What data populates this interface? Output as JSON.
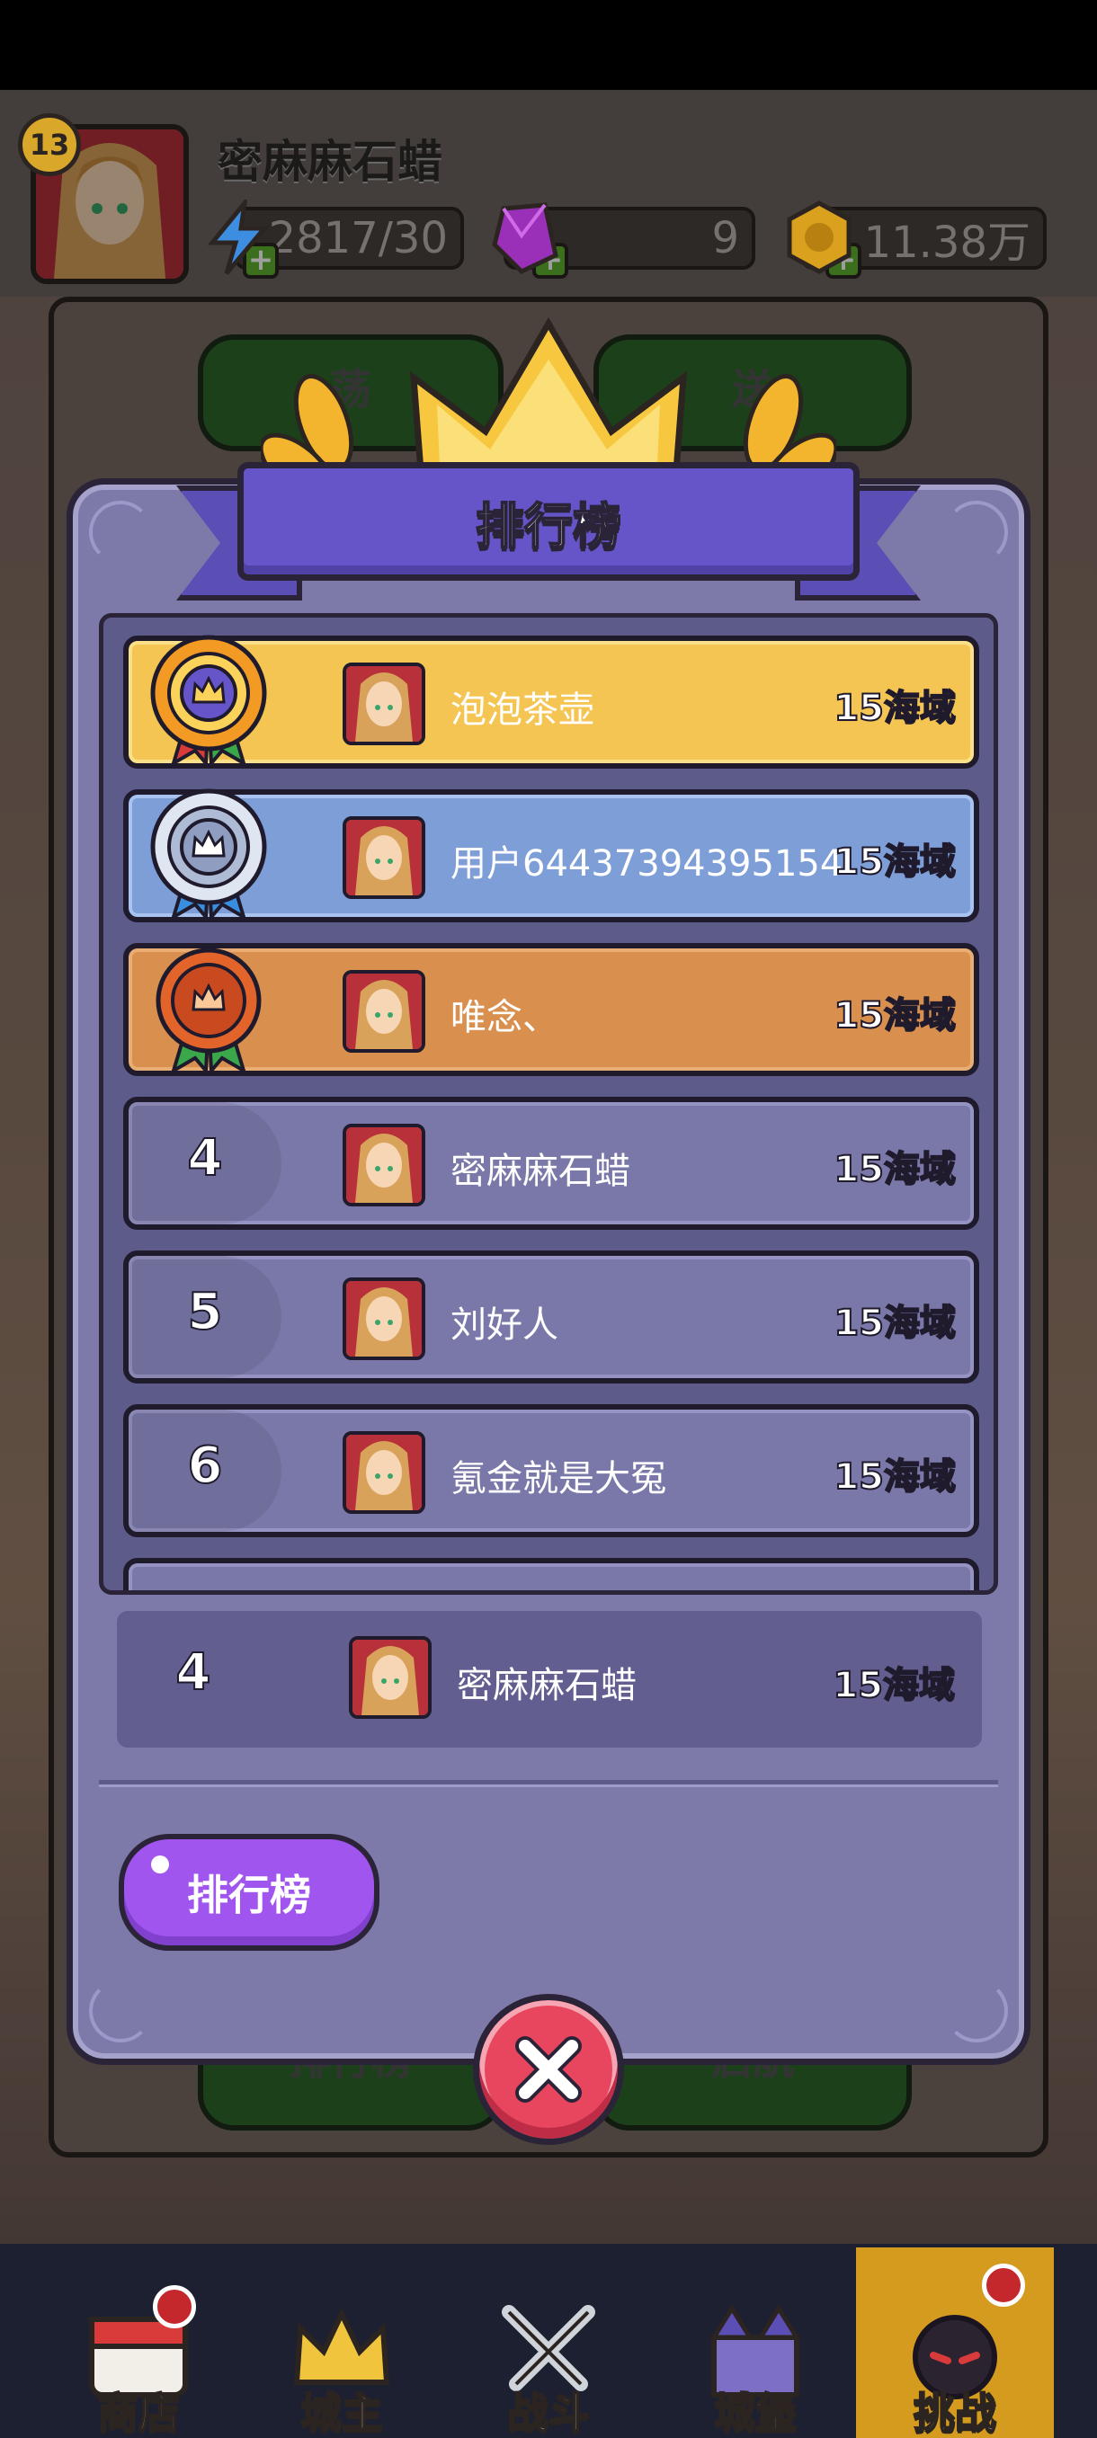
{
  "player": {
    "level": "13",
    "name": "密麻麻石蜡",
    "energy": "2817/30",
    "gems": "9",
    "coins": "11.38万"
  },
  "background_buttons": {
    "top_left": "荡",
    "top_right": "送",
    "bottom_left": "排行榜",
    "bottom_right": "启航"
  },
  "modal": {
    "title": "排行榜",
    "rows": [
      {
        "rank": "1",
        "name": "泡泡茶壶",
        "zone": "15海域",
        "style": "gold"
      },
      {
        "rank": "2",
        "name": "用户64437394395154",
        "zone": "15海域",
        "style": "silver"
      },
      {
        "rank": "3",
        "name": "唯念、",
        "zone": "15海域",
        "style": "bronze"
      },
      {
        "rank": "4",
        "name": "密麻麻石蜡",
        "zone": "15海域",
        "style": "plain"
      },
      {
        "rank": "5",
        "name": "刘好人",
        "zone": "15海域",
        "style": "plain"
      },
      {
        "rank": "6",
        "name": "氪金就是大冤",
        "zone": "15海域",
        "style": "plain"
      }
    ],
    "my_rank": {
      "rank": "4",
      "name": "密麻麻石蜡",
      "zone": "15海域"
    },
    "tab_label": "排行榜"
  },
  "nav": {
    "items": [
      {
        "label": "商店",
        "icon": "shop-icon"
      },
      {
        "label": "城主",
        "icon": "crown-icon"
      },
      {
        "label": "战斗",
        "icon": "swords-icon"
      },
      {
        "label": "城堡",
        "icon": "castle-icon"
      },
      {
        "label": "挑战",
        "icon": "bomb-icon",
        "active": true
      }
    ]
  }
}
